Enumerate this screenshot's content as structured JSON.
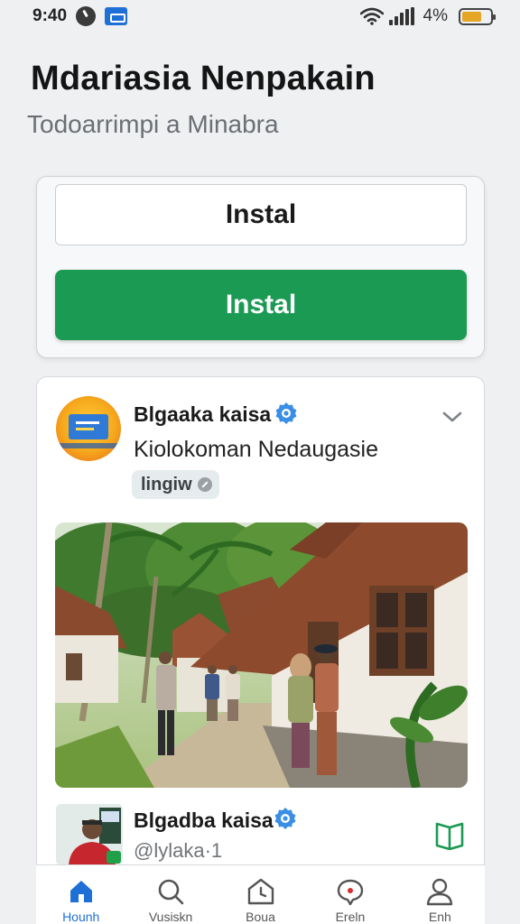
{
  "status_bar": {
    "time": "9:40",
    "battery_pct": "4%",
    "battery_level": 0.7
  },
  "header": {
    "title": "Mdariasia Nenpakain",
    "subtitle": "Todoarrimpi a Minabra"
  },
  "install_card": {
    "outline_button_label": "Instal",
    "primary_button_label": "Instal",
    "primary_color": "#1b9a54"
  },
  "post": {
    "author_name": "Blgaaka kaisa",
    "subtitle": "Kiolokoman Nedaugasie",
    "tag_label": "lingiw",
    "verified_color": "#3a8ee6",
    "footer_author_name": "Blgadba kaisa",
    "footer_handle": "@lylaka·1"
  },
  "bottom_nav": {
    "items": [
      {
        "label": "Hounh",
        "icon": "home-icon"
      },
      {
        "label": "Vusiskn",
        "icon": "search-icon"
      },
      {
        "label": "Boua",
        "icon": "pentagon-icon"
      },
      {
        "label": "Ereln",
        "icon": "chat-icon"
      },
      {
        "label": "Enh",
        "icon": "profile-icon"
      }
    ],
    "active_color": "#1e6fd6"
  }
}
